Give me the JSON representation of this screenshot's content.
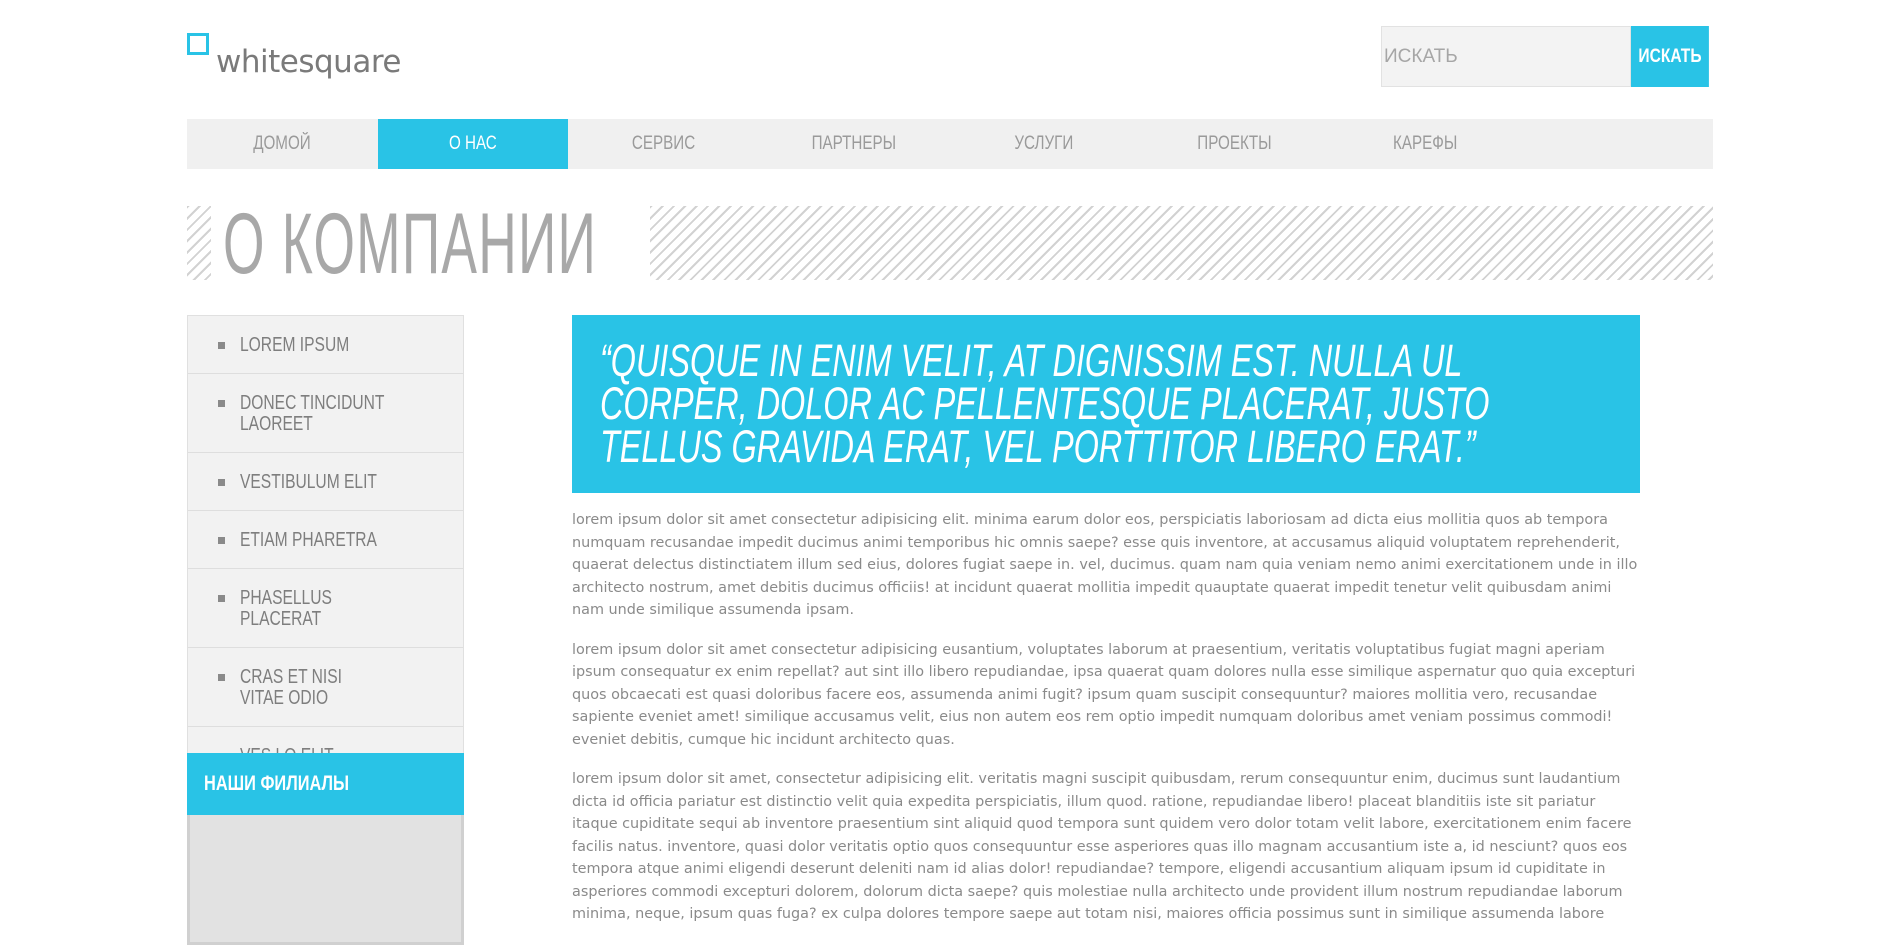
{
  "header": {
    "logo_text": "whitesquare",
    "search": {
      "placeholder": "ИСКАТЬ",
      "button_label": "ИСКАТЬ"
    }
  },
  "nav": {
    "items": [
      {
        "label": "ДОМОЙ",
        "active": false
      },
      {
        "label": "О НАС",
        "active": true
      },
      {
        "label": "СЕРВИС",
        "active": false
      },
      {
        "label": "ПАРТНЕРЫ",
        "active": false
      },
      {
        "label": "УСЛУГИ",
        "active": false
      },
      {
        "label": "ПРОЕКТЫ",
        "active": false
      },
      {
        "label": "КАРЕФЫ",
        "active": false
      }
    ]
  },
  "page_title": "О КОМПАНИИ",
  "sidebar": {
    "items": [
      {
        "label": "LOREM IPSUM"
      },
      {
        "label": "DONEC TINCIDUNT LAOREET"
      },
      {
        "label": "VESTIBULUM ELIT"
      },
      {
        "label": "ETIAM PHARETRA"
      },
      {
        "label": "PHASELLUS PLACERAT"
      },
      {
        "label": "CRAS ET NISI VITAE ODIO"
      },
      {
        "label": "VES LO ELIT"
      }
    ],
    "branches_title": "НАШИ ФИЛИАЛЫ"
  },
  "main": {
    "quote": "“QUISQUE IN ENIM VELIT, AT DIGNISSIM EST. NULLA UL CORPER, DOLOR AC PELLENTESQUE PLACERAT, JUSTO TELLUS GRAVIDA ERAT, VEL PORTTITOR LIBERO ERAT.”",
    "paragraphs": [
      "lorem ipsum dolor sit amet consectetur adipisicing elit. minima earum dolor eos, perspiciatis laboriosam ad dicta eius mollitia quos ab tempora numquam recusandae impedit ducimus animi temporibus hic omnis saepe? esse quis inventore, at accusamus aliquid voluptatem reprehenderit, quaerat delectus distinctiatem illum sed eius, dolores fugiat saepe in. vel, ducimus. quam nam quia veniam nemo animi exercitationem unde in illo architecto nostrum, amet debitis ducimus officiis! at incidunt quaerat mollitia impedit quauptate quaerat impedit tenetur velit quibusdam animi nam unde similique assumenda ipsam.",
      "lorem ipsum dolor sit amet consectetur adipisicing eusantium, voluptates laborum at praesentium, veritatis voluptatibus fugiat magni aperiam ipsum consequatur ex enim repellat? aut sint illo libero repudiandae, ipsa quaerat quam dolores nulla esse similique aspernatur quo quia excepturi quos obcaecati est quasi doloribus facere eos, assumenda animi fugit? ipsum quam suscipit consequuntur? maiores mollitia vero, recusandae sapiente eveniet amet! similique accusamus velit, eius non autem eos rem optio impedit numquam doloribus amet veniam possimus commodi! eveniet debitis, cumque hic incidunt architecto quas.",
      "lorem ipsum dolor sit amet, consectetur adipisicing elit. veritatis magni suscipit quibusdam, rerum consequuntur enim, ducimus sunt laudantium dicta id officia pariatur est distinctio velit quia expedita perspiciatis, illum quod. ratione, repudiandae libero! placeat blanditiis iste sit pariatur itaque cupiditate sequi ab inventore praesentium sint aliquid quod tempora sunt quidem vero dolor totam velit labore, exercitationem enim facere facilis natus. inventore, quasi dolor veritatis optio quos consequuntur esse asperiores quas illo magnam accusantium iste a, id nesciunt? quos eos tempora atque animi eligendi deserunt deleniti nam id alias dolor! repudiandae? tempore, eligendi accusantium aliquam ipsum id cupiditate in asperiores commodi excepturi dolorem, dolorum dicta saepe? quis molestiae nulla architecto unde provident illum nostrum repudiandae laborum minima, neque, ipsum quas fuga? ex culpa dolores tempore saepe aut totam nisi, maiores officia possimus sunt in similique assumenda labore"
    ]
  },
  "colors": {
    "accent": "#29c3e6",
    "nav_bg": "#f0f0f0",
    "text": "#8a8a8a"
  }
}
